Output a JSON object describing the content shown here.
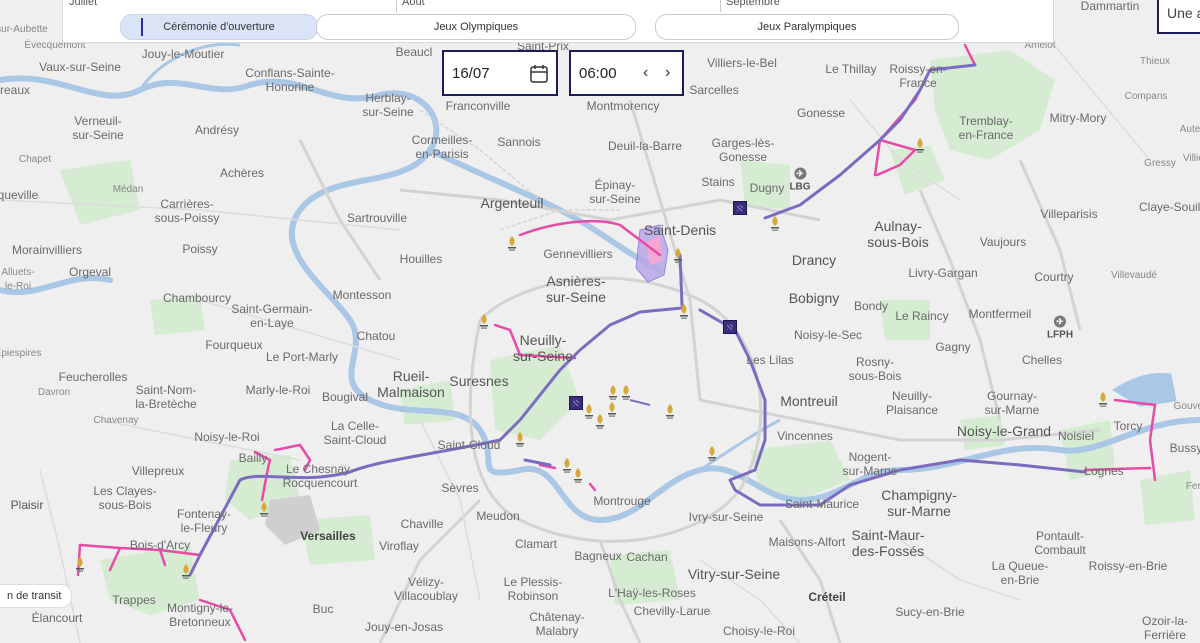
{
  "colors": {
    "route_pink": "#e84aa8",
    "route_purple": "#7c6cc0",
    "accent_navy": "#1d1c5a",
    "water": "#a9c6e3",
    "green": "#dcefd8"
  },
  "months": [
    "Juillet",
    "Août",
    "Septembre"
  ],
  "tabs": [
    {
      "label": "Cérémonie d'ouverture",
      "active": true
    },
    {
      "label": "Jeux Olympiques",
      "active": false
    },
    {
      "label": "Jeux Paralympiques",
      "active": false
    }
  ],
  "date_value": "16/07",
  "time_value": "06:00",
  "search_text": "Une a",
  "legend_button": "n de transit",
  "airports": [
    {
      "code": "LBG"
    },
    {
      "code": "LFPH"
    }
  ],
  "places": [
    "Dammartin",
    "sur-Aubette",
    "Évecquemont",
    "Jouy-le-Moutier",
    "Beaucl",
    "Saint-Prix",
    "Villiers-le-Bel",
    "Le Thillay",
    "Roissy-en-France",
    "Amelot",
    "Thieux",
    "Vaux-sur-Seine",
    "Conflans-Sainte-Honorine",
    "Franconville",
    "Montmorency",
    "Sarcelles",
    "Compans",
    "Herblay-sur-Seine",
    "Gonesse",
    "Tremblay-en-France",
    "Mitry-Mory",
    "Verneuil-sur-Seine",
    "Andrésy",
    "Cormeilles-en-Parisis",
    "Sannois",
    "Deuil-la-Barre",
    "Garges-lès-Gonesse",
    "Chapet",
    "Achères",
    "Stains",
    "Dugny",
    "Gressy",
    "Épinay-sur-Seine",
    "Médan",
    "Argenteuil",
    "Claye-Souilly",
    "Carrières-sous-Poissy",
    "Sartrouville",
    "Saint-Denis",
    "Aulnay-sous-Bois",
    "Villeparisis",
    "Poissy",
    "Gennevilliers",
    "Vaujours",
    "Morainvilliers",
    "Orgeval",
    "Houilles",
    "Drancy",
    "Livry-Gargan",
    "Courtry",
    "Villevaudé",
    "Asnières-sur-Seine",
    "Chambourcy",
    "Montesson",
    "Bobigny",
    "Saint-Germain-en-Laye",
    "Bondy",
    "Le Raincy",
    "Montfermeil",
    "Chatou",
    "Noisy-le-Sec",
    "Fourqueux",
    "Neuilly-sur-Seine",
    "Le Port-Marly",
    "Gagny",
    "Les Lilas",
    "Rosny-sous-Bois",
    "Chelles",
    "Feucherolles",
    "Rueil-Malmaison",
    "Suresnes",
    "Marly-le-Roi",
    "Saint-Nom-la-Bretèche",
    "Bougival",
    "Montreuil",
    "Neuilly-Plaisance",
    "Gournay-sur-Marne",
    "Davron",
    "La Celle-Saint-Cloud",
    "Noisy-le-Grand",
    "Chavenay",
    "Vincennes",
    "Noisiel",
    "Torcy",
    "Noisy-le-Roi",
    "Saint-Cloud",
    "Nogent-sur-Marne",
    "Bailly",
    "Le Chesnay-Rocquencourt",
    "Lognes",
    "Villepreux",
    "Sèvres",
    "Champigny-sur-Marne",
    "Les Clayes-sous-Bois",
    "Saint-Maurice",
    "Fontenay-le-Fleury",
    "Meudon",
    "Montrouge",
    "Ivry-sur-Seine",
    "Plaisir",
    "Versailles",
    "Chaville",
    "Saint-Maur-des-Fossés",
    "Pontault-Combault",
    "Bois-d'Arcy",
    "Viroflay",
    "Clamart",
    "Bagneux",
    "Cachan",
    "Maisons-Alfort",
    "Vitry-sur-Seine",
    "Créteil",
    "La Queue-en-Brie",
    "Roissy-en-Brie",
    "Trappes",
    "Vélizy-Villacoublay",
    "Le Plessis-Robinson",
    "L'Haÿ-les-Roses",
    "Montigny-le-Bretonneux",
    "Buc",
    "Élancourt",
    "Châtenay-Malabry",
    "Chevilly-Larue",
    "Sucy-en-Brie",
    "Jouy-en-Josas",
    "Choisy-le-Roi",
    "Ozoir-la-Ferrière",
    "Gouver",
    "Bussy-",
    "Ferr",
    "Villier",
    "Alluets-le-Roi",
    "Épiespires",
    "Auteuil",
    "queville",
    "reaux",
    "Plaisir"
  ]
}
